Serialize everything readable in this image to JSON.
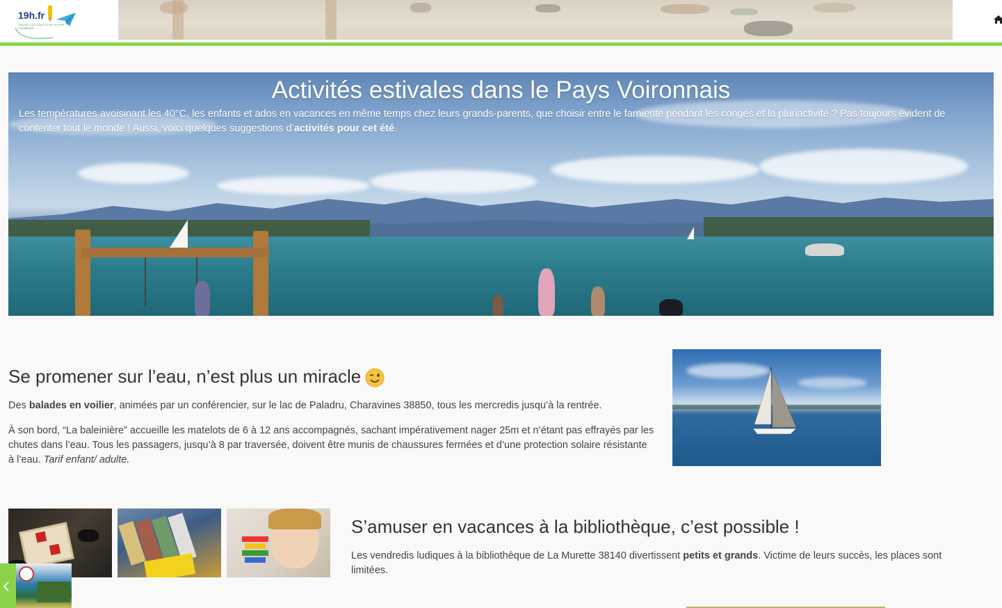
{
  "header": {
    "logo_text": "19h.fr",
    "logo_tagline": "TOUTE L'ACTUALITÉ DE VOTRE COMMUNE"
  },
  "hero": {
    "title": "Activités estivales dans le Pays Voironnais",
    "intro_before": "Les températures avoisinant les 40°C, les enfants et ados en vacances en même temps chez leurs grands-parents, que choisir entre le farniente pendant les congés et la pluriactivité ? Pas toujours évident de contenter tout le monde ! Aussi, voici quelques suggestions d’",
    "intro_bold": "activités pour cet été",
    "intro_after": "."
  },
  "section1": {
    "title": "Se promener sur l’eau, n’est plus un miracle",
    "p1_before": "Des ",
    "p1_bold": "balades en voilier",
    "p1_after": ", animées par un conférencier, sur le lac de Paladru, Charavines 38850, tous les mercredis jusqu’à la rentrée.",
    "p2_text": "À son bord, “La baleinière” accueille les matelots de 6 à 12 ans accompagnés,  sachant impérativement nager 25m et n’étant pas effrayés par les chutes dans l’eau. Tous les passagers, jusqu’à 8 par traversée, doivent être munis de chaussures fermées et d’une protection solaire résistante à l’eau. ",
    "p2_italic": "Tarif enfant/ adulte."
  },
  "section2": {
    "title": "S’amuser en vacances à la bibliothèque, c’est possible !",
    "p_before": "Les vendredis ludiques à la bibliothèque de La Murette 38140 divertissent ",
    "p_bold": "petits et grands",
    "p_after": ". Victime de leurs succès, les places sont limitées."
  },
  "icons": {
    "home": "home-icon",
    "wink": "winking-face-emoji",
    "prev": "chevron-left-icon"
  },
  "colors": {
    "accent_green": "#8bd44a",
    "hero_text": "#ffffff"
  }
}
